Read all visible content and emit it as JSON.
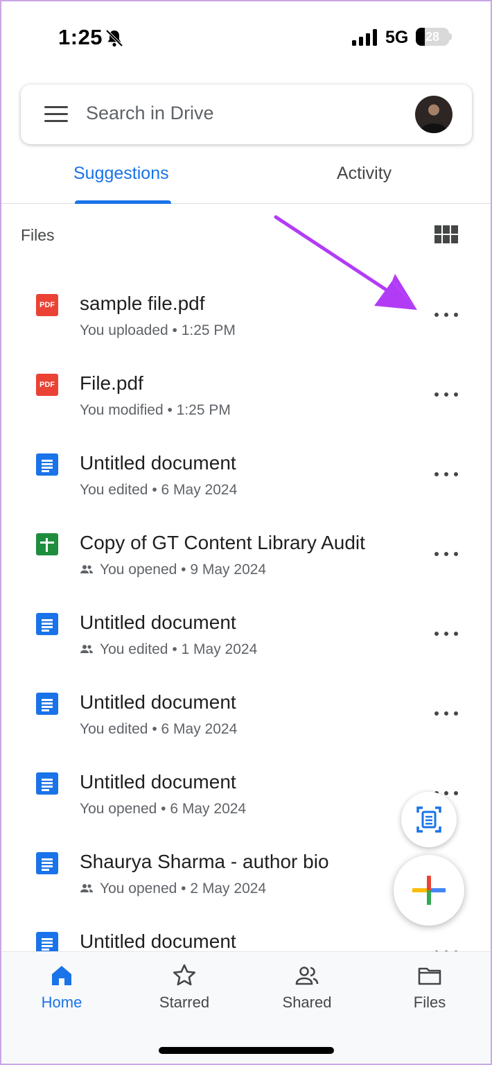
{
  "status_bar": {
    "time": "1:25",
    "network": "5G",
    "battery": "28",
    "battery_level": 0.28
  },
  "search": {
    "placeholder": "Search in Drive"
  },
  "tabs": [
    {
      "label": "Suggestions",
      "active": true
    },
    {
      "label": "Activity",
      "active": false
    }
  ],
  "section": {
    "label": "Files"
  },
  "files": [
    {
      "title": "sample file.pdf",
      "meta": "You uploaded • 1:25 PM",
      "type": "pdf",
      "shared": false
    },
    {
      "title": "File.pdf",
      "meta": "You modified • 1:25 PM",
      "type": "pdf",
      "shared": false
    },
    {
      "title": "Untitled document",
      "meta": "You edited • 6 May 2024",
      "type": "doc",
      "shared": false
    },
    {
      "title": "Copy of GT Content Library Audit",
      "meta": "You opened • 9 May 2024",
      "type": "sheet",
      "shared": true
    },
    {
      "title": "Untitled document",
      "meta": "You edited • 1 May 2024",
      "type": "doc",
      "shared": true
    },
    {
      "title": "Untitled document",
      "meta": "You edited • 6 May 2024",
      "type": "doc",
      "shared": false
    },
    {
      "title": "Untitled document",
      "meta": "You opened • 6 May 2024",
      "type": "doc",
      "shared": false
    },
    {
      "title": "Shaurya Sharma - author bio",
      "meta": "You opened • 2 May 2024",
      "type": "doc",
      "shared": true
    },
    {
      "title": "Untitled document",
      "meta": "",
      "type": "doc",
      "shared": false
    }
  ],
  "bottom_nav": [
    {
      "label": "Home",
      "icon": "home-icon",
      "active": true
    },
    {
      "label": "Starred",
      "icon": "star-icon",
      "active": false
    },
    {
      "label": "Shared",
      "icon": "people-icon",
      "active": false
    },
    {
      "label": "Files",
      "icon": "folder-icon",
      "active": false
    }
  ],
  "colors": {
    "accent": "#1a73e8",
    "annotation_arrow": "#b23cf6",
    "pdf": "#ea4335",
    "sheet": "#1e8e3e"
  }
}
